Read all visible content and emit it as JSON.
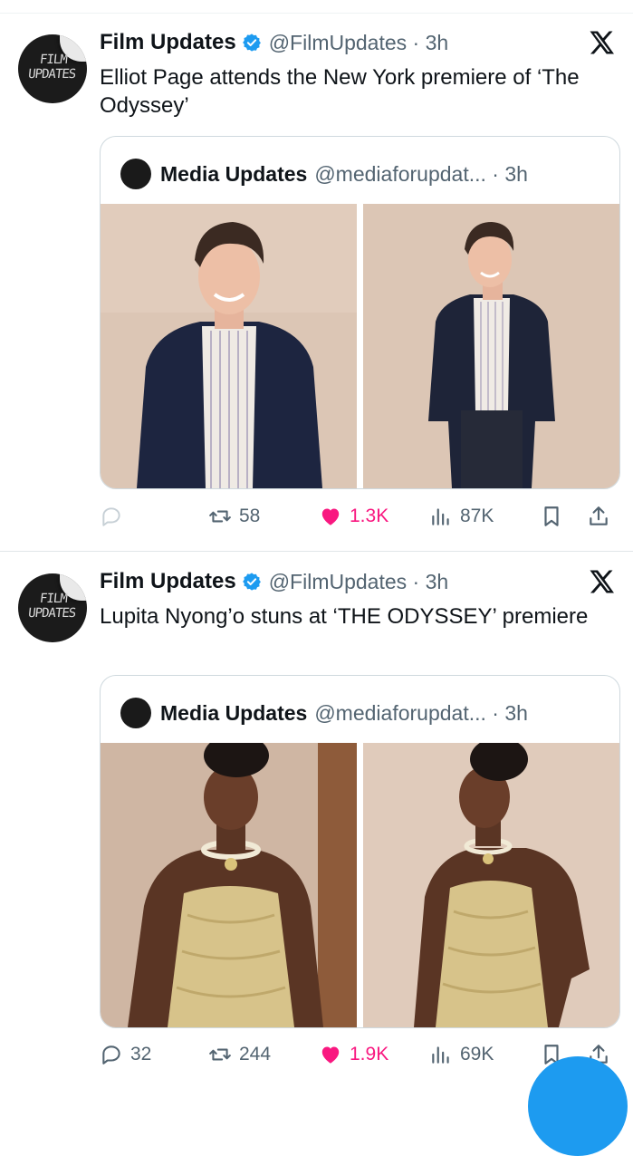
{
  "tweets": [
    {
      "author_name": "Film Updates",
      "author_handle": "@FilmUpdates · 3h",
      "avatar_text": "FILM UPDATES",
      "text": "Elliot Page attends the New York premiere of ‘The Odyssey’",
      "quote": {
        "author_name": "Media Updates",
        "author_handle": "@mediaforupdat... · 3h"
      },
      "actions": {
        "replies": "",
        "reposts": "58",
        "likes": "1.3K",
        "views": "87K"
      }
    },
    {
      "author_name": "Film Updates",
      "author_handle": "@FilmUpdates · 3h",
      "avatar_text": "FILM UPDATES",
      "text": "Lupita Nyong’o stuns at ‘THE ODYSSEY’ premiere",
      "quote": {
        "author_name": "Media Updates",
        "author_handle": "@mediaforupdat... · 3h"
      },
      "actions": {
        "replies": "32",
        "reposts": "244",
        "likes": "1.9K",
        "views": "69K"
      }
    }
  ],
  "icons": [
    "verified-badge-icon",
    "x-logo-icon",
    "reply-icon",
    "repost-icon",
    "like-icon",
    "views-icon",
    "bookmark-icon",
    "share-icon"
  ],
  "colors": {
    "accent": "#1d9bf0",
    "like": "#f91880",
    "muted": "#536471"
  }
}
